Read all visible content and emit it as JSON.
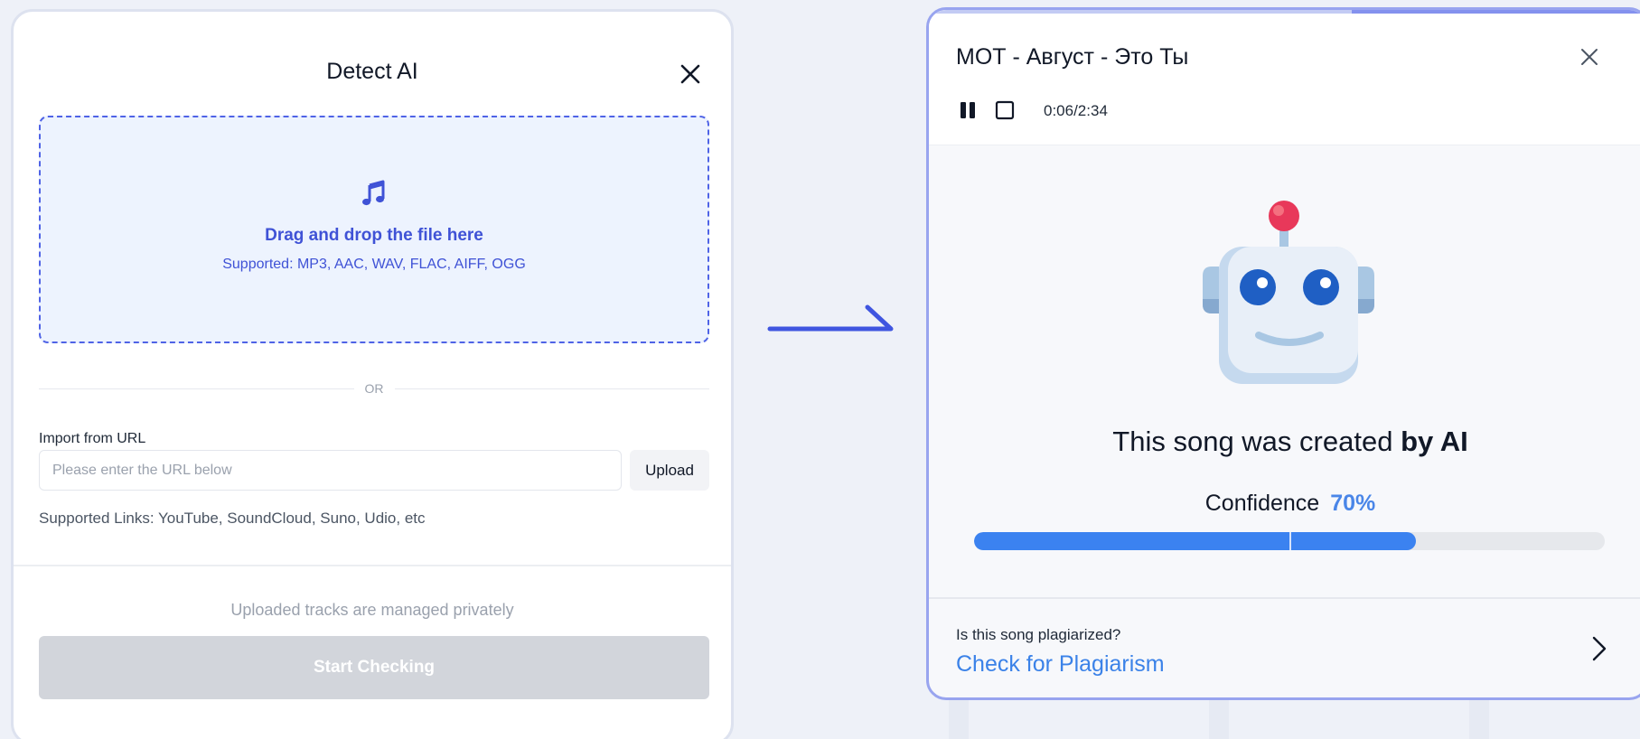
{
  "upload_dialog": {
    "title": "Detect AI",
    "close_icon": "close-icon",
    "dropzone": {
      "icon": "music-note-icon",
      "title": "Drag and drop the file here",
      "supported": "Supported: MP3, AAC, WAV, FLAC, AIFF, OGG"
    },
    "divider_text": "OR",
    "url_import": {
      "label": "Import from URL",
      "placeholder": "Please enter the URL below",
      "value": "",
      "upload_label": "Upload",
      "supported_links": "Supported Links: YouTube, SoundCloud, Suno, Udio, etc"
    },
    "privacy_note": "Uploaded tracks are managed privately",
    "start_label": "Start Checking"
  },
  "result_dialog": {
    "track_title": "МОТ - Август - Это Ты",
    "player": {
      "time": "0:06/2:34",
      "pause_icon": "pause-icon",
      "stop_icon": "stop-icon",
      "progress": 0.04
    },
    "verdict_prefix": "This song was created",
    "verdict_emphasis": "by AI",
    "confidence_label": "Confidence",
    "confidence_text": "70%",
    "confidence_value": 0.7,
    "plagiarism_question": "Is this song plagiarized?",
    "plagiarism_link": "Check for Plagiarism"
  },
  "colors": {
    "accent_blue": "#3b82f0",
    "dropzone_blue": "#3f52d6",
    "panel_border": "#98a4ef",
    "robot_antenna": "#e8385a"
  }
}
